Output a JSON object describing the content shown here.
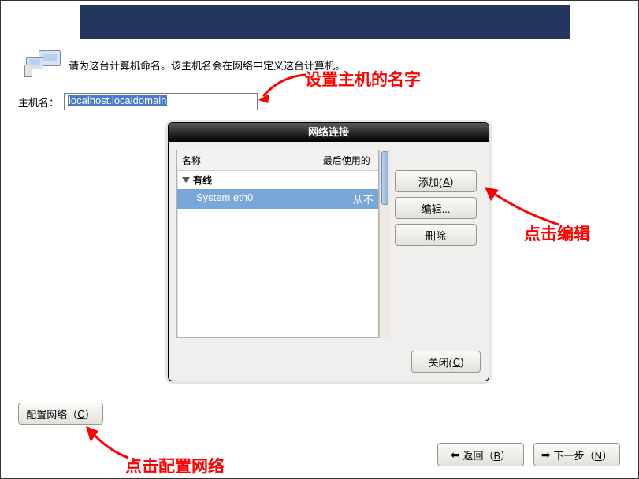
{
  "instruction": "请为这台计算机命名。该主机名会在网络中定义这台计算机。",
  "hostname": {
    "label": "主机名：",
    "value": "localhost.localdomain"
  },
  "dialog": {
    "title": "网络连接",
    "columns": {
      "name": "名称",
      "lastused": "最后使用的"
    },
    "group": "有线",
    "items": [
      {
        "name": "System eth0",
        "lastused": "从不"
      }
    ],
    "buttons": {
      "add": "添加(",
      "add_u": "A",
      "add2": ")",
      "edit": "编辑...",
      "delete": "删除",
      "close": "关闭(",
      "close_u": "C",
      "close2": ")"
    }
  },
  "footer": {
    "cfg_net": "配置网络（",
    "cfg_net_u": "C",
    "cfg_net2": "）",
    "back": "返回（",
    "back_u": "B",
    "back2": "）",
    "next": "下一步（",
    "next_u": "N",
    "next2": "）"
  },
  "annotations": {
    "a1": "设置主机的名字",
    "a2": "点击编辑",
    "a3": "点击配置网络"
  }
}
